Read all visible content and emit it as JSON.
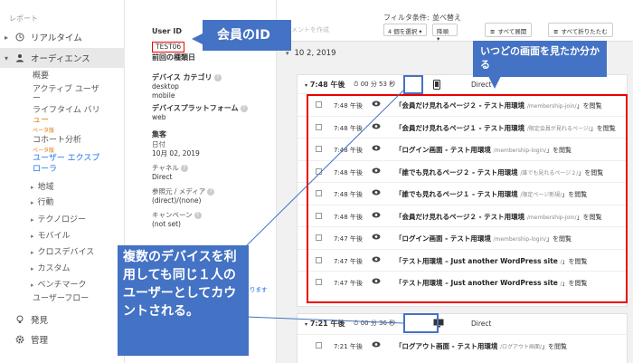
{
  "sidebar": {
    "section_label": "レポート",
    "realtime": "リアルタイム",
    "audience": "オーディエンス",
    "sub_items": [
      "概要",
      "アクティブ ユーザ",
      "ー",
      "ライフタイム バリ",
      "ュー"
    ],
    "beta1": "ベータ版",
    "cohort": "コホート分析",
    "beta2": "ベータ版",
    "user_explorer_1": "ユーザー エクスプ",
    "user_explorer_2": "ローラ",
    "groups": [
      "地域",
      "行動",
      "テクノロジー",
      "モバイル",
      "クロスデバイス",
      "カスタム",
      "ベンチマーク"
    ],
    "user_flow": "ユーザーフロー",
    "discover": "発見",
    "admin": "管理"
  },
  "info": {
    "user_id_label": "User ID",
    "user_id_value": "TEST06",
    "prev_visit_label": "前回の種類日",
    "device_category_label": "デバイス カテゴリ",
    "device_category_values": [
      "desktop",
      "mobile"
    ],
    "device_platform_label": "デバイスプラットフォーム",
    "device_platform_value": "web",
    "acquisition_label": "集客",
    "date_label": "日付",
    "date_value": "10月 02, 2019",
    "channel_label": "チャネル",
    "channel_value": "Direct",
    "source_label": "参照元 / メディア",
    "source_value": "(direct)/(none)",
    "campaign_label": "キャンペーン",
    "campaign_value": "(not set)",
    "cut_text": "ります"
  },
  "toolbar": {
    "filter_label": "フィルタ条件:",
    "sort_label": "並べ替え",
    "comment_faded": "メントを作成",
    "filter_select": "4 個を選択",
    "sort_select": "降順",
    "expand_all": "すべて展開",
    "collapse_all": "すべて折りたたむ"
  },
  "date_heading": "10 2, 2019",
  "session1": {
    "time": "7:48 午後",
    "duration": "00 分 53 秒",
    "source": "Direct",
    "hits": [
      {
        "time": "7:48 午後",
        "title": "「会員だけ見れるページ２ - テスト用環境",
        "path": "/membership-join/",
        "tail": "」を閲覧"
      },
      {
        "time": "7:48 午後",
        "title": "「会員だけ見れるページ１ - テスト用環境",
        "path": "/限定会員が見れるページ/",
        "tail": "」を閲覧"
      },
      {
        "time": "7:48 午後",
        "title": "「ログイン画面 - テスト用環境",
        "path": "/membership-login/",
        "tail": "」を閲覧"
      },
      {
        "time": "7:48 午後",
        "title": "「誰でも見れるページ２ - テスト用環境",
        "path": "/誰でも見れるページ２/",
        "tail": "」を閲覧"
      },
      {
        "time": "7:48 午後",
        "title": "「誰でも見れるページ１ - テスト用環境",
        "path": "/限定ページ新規/",
        "tail": "」を閲覧"
      },
      {
        "time": "7:48 午後",
        "title": "「会員だけ見れるページ２ - テスト用環境",
        "path": "/membership-join/",
        "tail": "」を閲覧"
      },
      {
        "time": "7:47 午後",
        "title": "「ログイン画面 - テスト用環境",
        "path": "/membership-login/",
        "tail": "」を閲覧"
      },
      {
        "time": "7:47 午後",
        "title": "「テスト用環境 – Just another WordPress site",
        "path": "/",
        "tail": "」を閲覧"
      },
      {
        "time": "7:47 午後",
        "title": "「テスト用環境 – Just another WordPress site",
        "path": "/",
        "tail": "」を閲覧"
      }
    ]
  },
  "session2": {
    "time": "7:21 午後",
    "duration": "00 分 36 秒",
    "source": "Direct",
    "hits": [
      {
        "time": "7:21 午後",
        "title": "「ログアウト画面 - テスト用環境",
        "path": "/ログアウト画面/",
        "tail": "」を閲覧"
      }
    ]
  },
  "annotations": {
    "member_id": "会員のID",
    "screen_note": "いつどの画面を見たか分かる",
    "device_note": "複数のデバイスを利用しても同じ１人のユーザーとしてカウントされる。"
  },
  "colors": {
    "accent": "#1a73e8",
    "callout": "#4472c4",
    "highlight": "#e00000"
  }
}
